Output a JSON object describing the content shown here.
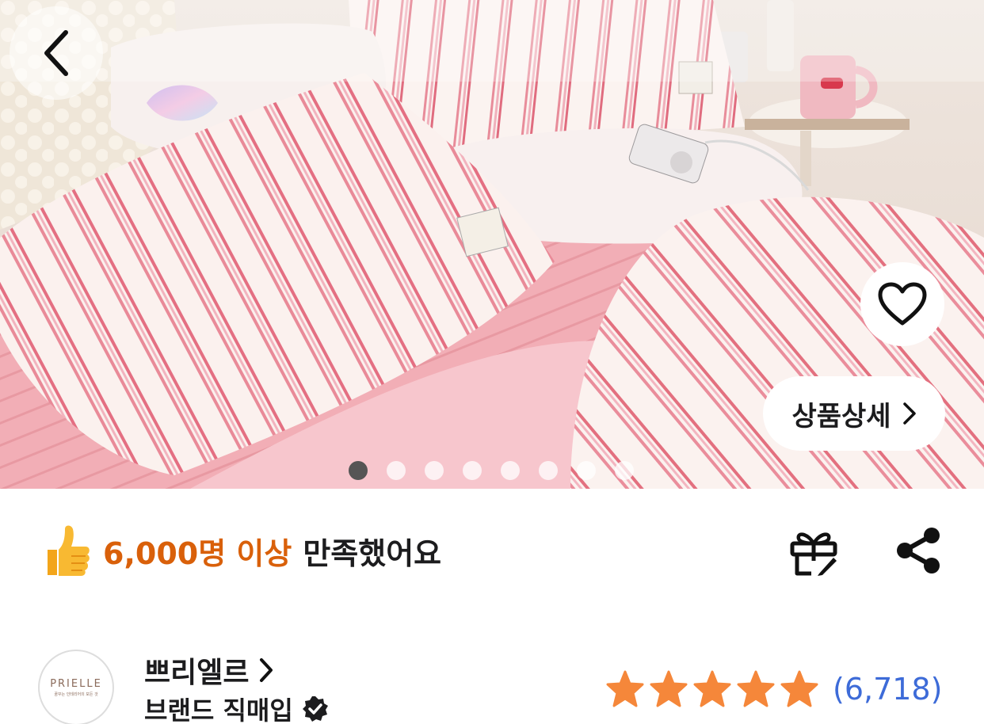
{
  "header": {
    "back_icon": "chevron-left-icon"
  },
  "hero": {
    "favorite_icon": "heart-outline-icon",
    "detail_button_label": "상품상세",
    "detail_button_icon": "chevron-right-icon",
    "carousel": {
      "total": 8,
      "active_index": 0
    }
  },
  "satisfaction": {
    "icon": "thumbs-up-icon",
    "highlight": "6,000명 이상",
    "rest": "만족했어요",
    "gift_icon": "gift-icon",
    "share_icon": "share-icon"
  },
  "brand": {
    "logo_text": "PRIELLE",
    "logo_subtext": "꿈꾸는 인테리어의 모든 것",
    "name": "쁘리엘르",
    "name_icon": "chevron-right-icon",
    "type": "브랜드 직매입",
    "verified_icon": "verified-badge-icon"
  },
  "rating": {
    "stars": 5,
    "review_count": "(6,718)",
    "star_color": "#f5873a"
  },
  "colors": {
    "accent_orange": "#d9600a",
    "link_blue": "#3d6bd8"
  }
}
